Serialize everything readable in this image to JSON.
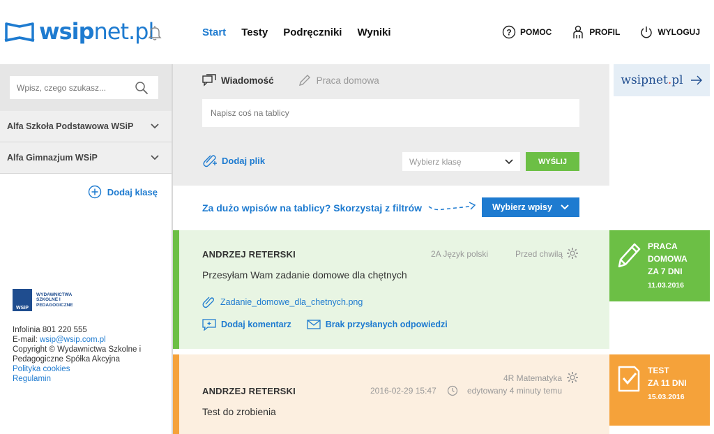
{
  "header": {
    "logo_prefix": "wsip",
    "logo_suffix": "net.pl",
    "nav": [
      {
        "label": "Start",
        "active": true
      },
      {
        "label": "Testy",
        "active": false
      },
      {
        "label": "Podręczniki",
        "active": false
      },
      {
        "label": "Wyniki",
        "active": false
      }
    ],
    "help_label": "POMOC",
    "profile_label": "PROFIL",
    "logout_label": "WYLOGUJ"
  },
  "sidebar": {
    "search_placeholder": "Wpisz, czego szukasz...",
    "schools": [
      {
        "label": "Alfa Szkoła Podstawowa WSiP"
      },
      {
        "label": "Alfa Gimnazjum WSiP"
      }
    ],
    "add_class_label": "Dodaj klasę"
  },
  "footer": {
    "wsip_box": "WSiP",
    "wsip_name": "WYDAWNICTWA SZKOLNE I PEDAGOGICZNE",
    "infolinia": "Infolinia 801 220 555",
    "email_label": "E-mail: ",
    "email": "wsip@wsip.com.pl",
    "copyright": "Copyright © Wydawnictwa Szkolne i Pedagogiczne Spółka Akcyjna",
    "cookies": "Polityka cookies",
    "regulamin": "Regulamin"
  },
  "composer": {
    "tab_message": "Wiadomość",
    "tab_homework": "Praca domowa",
    "input_placeholder": "Napisz coś na tablicy",
    "add_file": "Dodaj plik",
    "class_select": "Wybierz klasę",
    "send": "WYŚLIJ"
  },
  "filter": {
    "text": "Za dużo wpisów na tablicy? Skorzystaj z filtrów",
    "button": "Wybierz wpisy"
  },
  "posts": [
    {
      "author": "ANDRZEJ RETERSKI",
      "class_subject": "2A Język polski",
      "time": "Przed chwilą",
      "text": "Przesyłam Wam zadanie domowe dla chętnych",
      "attachment": "Zadanie_domowe_dla_chetnych.png",
      "add_comment": "Dodaj komentarz",
      "responses": "Brak przysłanych odpowiedzi"
    },
    {
      "author": "ANDRZEJ RETERSKI",
      "class_subject": "4R Matematyka",
      "datetime": "2016-02-29 15:47",
      "edited": "edytowany 4 minuty temu",
      "text": "Test do zrobienia"
    }
  ],
  "right": {
    "logo_a": "wsipnet",
    "logo_dot": ".",
    "logo_b": "pl",
    "badges": [
      {
        "line1": "PRACA",
        "line2": "DOMOWA",
        "line3": "ZA 7 DNI",
        "date": "11.03.2016",
        "color": "#6cbf45"
      },
      {
        "line1": "TEST",
        "line2": "ZA 11 DNI",
        "date": "15.03.2016",
        "color": "#f5a23a"
      }
    ]
  },
  "colors": {
    "accent": "#1e7bd0",
    "green": "#6cbf45",
    "orange": "#f5a23a"
  }
}
